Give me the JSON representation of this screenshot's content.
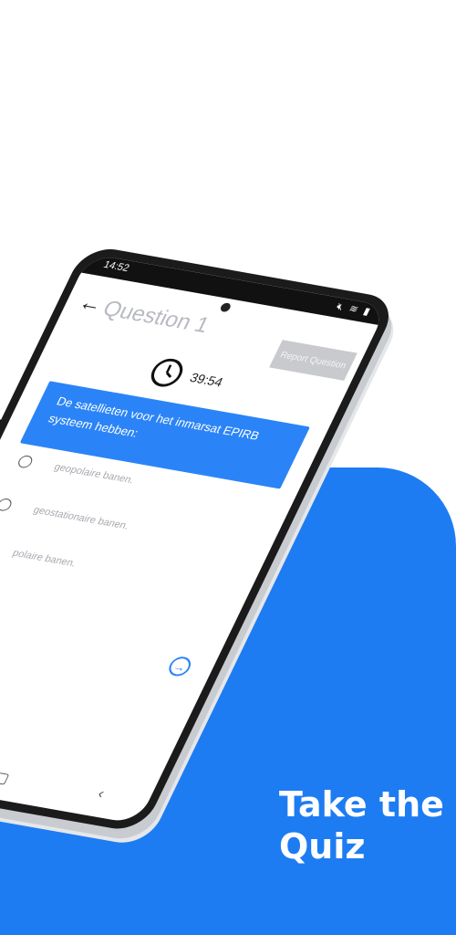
{
  "tagline": {
    "line1": "Take the",
    "line2": "Quiz"
  },
  "colors": {
    "panel": "#1e7cf2",
    "accent": "#2b84f7",
    "report_button": "#c9cacd"
  },
  "status_bar": {
    "time": "14:52",
    "icons": [
      "mute-icon",
      "wifi-icon",
      "battery-icon"
    ]
  },
  "header": {
    "back_icon": "arrow-left-icon",
    "title": "Question 1",
    "report_label": "Report Question"
  },
  "timer": {
    "icon": "clock-icon",
    "value": "39:54"
  },
  "question": {
    "text": "De satellieten voor het inmarsat EPIRB systeem hebben:"
  },
  "options": [
    {
      "label": "geopolaire banen."
    },
    {
      "label": "geostationaire banen."
    },
    {
      "label": "polaire banen."
    }
  ],
  "navigation": {
    "prev_icon": "arrow-left-circle-icon",
    "next_icon": "arrow-right-circle-icon"
  },
  "system_nav": {
    "recent": "|||",
    "home": "▢",
    "back": "‹"
  }
}
